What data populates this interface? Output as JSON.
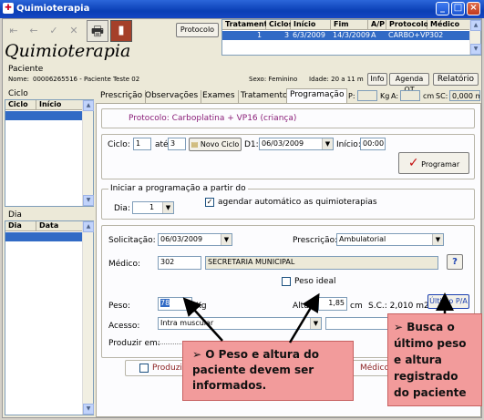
{
  "window": {
    "title": "Quimioterapia"
  },
  "toolbar": {
    "protocolo_button": "Protocolo"
  },
  "top_table": {
    "headers": [
      "Tratamento",
      "Ciclos",
      "Início",
      "Fim",
      "A/P",
      "Protocolo",
      "Médico"
    ],
    "row": [
      "1",
      "3",
      "6/3/2009",
      "14/3/2009",
      "A",
      "CARBO+VP",
      "302"
    ]
  },
  "app_title": "Quimioterapia",
  "paciente": {
    "section": "Paciente",
    "nome_label": "Nome:",
    "nome_value": "00006265516 - Paciente Teste 02",
    "sexo": "Sexo: Feminino",
    "idade": "Idade: 20 a 11 m",
    "info_button": "Info",
    "agenda_button": "Agenda QT",
    "relatorio_button": "Relatório"
  },
  "ciclo_panel": {
    "title": "Ciclo",
    "headers": [
      "Ciclo",
      "Início"
    ]
  },
  "dia_panel": {
    "title": "Dia",
    "headers": [
      "Dia",
      "Data"
    ]
  },
  "tabs": [
    "Prescrição",
    "Observações",
    "Exames",
    "Tratamento",
    "Programação"
  ],
  "tab_extras": {
    "p_label": "P:",
    "kg": "Kg",
    "a_label": "A:",
    "cm": "cm",
    "sc_label": "SC:",
    "sc_value": "0,000 m2"
  },
  "protocolo_line": "Protocolo:  Carboplatina + VP16 (criança)",
  "ciclo_row": {
    "ciclo_label": "Ciclo:",
    "ciclo_value": "1",
    "ate_label": "até",
    "ate_value": "3",
    "novo_ciclo": "Novo Ciclo",
    "d1_label": "D1:",
    "d1_value": "06/03/2009",
    "inicio_label": "Início:",
    "inicio_value": "00:00",
    "programar": "Programar"
  },
  "iniciar": {
    "title": "Iniciar a programação a partir do",
    "dia_label": "Dia:",
    "dia_value": "1",
    "agendar_label": "agendar automático as quimioterapias",
    "agendar_check": "✓"
  },
  "form": {
    "solicitacao_label": "Solicitação:",
    "solicitacao_value": "06/03/2009",
    "prescricao_label": "Prescrição:",
    "prescricao_value": "Ambulatorial",
    "medico_label": "Médico:",
    "medico_code": "302",
    "medico_name": "SECRETARIA MUNICIPAL",
    "help": "?",
    "peso_ideal_label": "Peso ideal",
    "peso_label": "Peso:",
    "peso_value": "78",
    "peso_unit": "Kg",
    "altura_label": "Altura:",
    "altura_value": "1,85",
    "altura_unit": "cm",
    "sc_text": "S.C.: 2,010 m2",
    "ultimo_button": "Último P/A",
    "acesso_label": "Acesso:",
    "acesso_value": "Intra muscular",
    "produzir_label": "Produzir em:"
  },
  "bottom": {
    "produzido_label": "Produzi",
    "medico_label": "Médico"
  },
  "callouts": {
    "left_title": "➢  O Peso e altura do paciente devem ser informados.",
    "right_title": "➢  Busca o último peso e altura registrado do paciente"
  }
}
